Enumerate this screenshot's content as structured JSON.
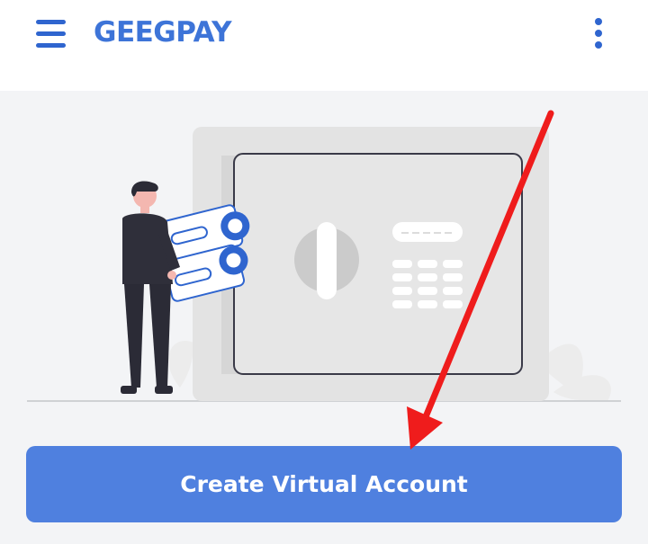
{
  "app_bar": {
    "title": "GEEGPAY",
    "menu_icon": "hamburger-menu-icon",
    "more_icon": "vertical-dots-icon"
  },
  "main": {
    "illustration": "person-depositing-cards-into-safe",
    "cta_label": "Create Virtual Account"
  },
  "annotation": {
    "type": "arrow",
    "color": "#ef1c1c"
  },
  "colors": {
    "brand": "#3d74d8",
    "button": "#4f80df",
    "background": "#f3f4f6"
  }
}
